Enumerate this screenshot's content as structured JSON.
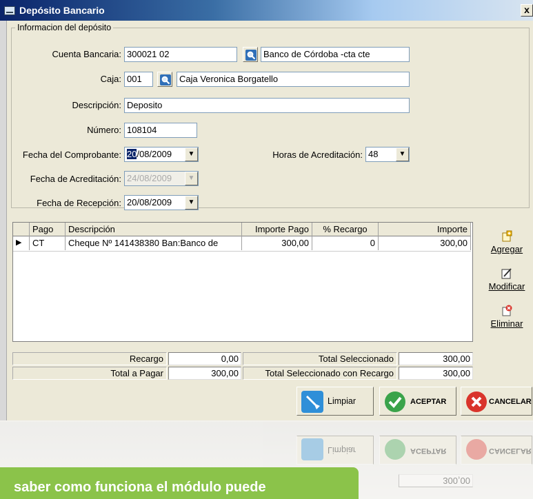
{
  "window": {
    "title": "Depósito Bancario",
    "close": "x"
  },
  "group": {
    "legend": "Informacion del depósito"
  },
  "form": {
    "cuenta_label": "Cuenta Bancaria:",
    "cuenta_value": "300021 02",
    "cuenta_name": "Banco de Córdoba -cta cte",
    "caja_label": "Caja:",
    "caja_value": "001",
    "caja_name": "Caja Veronica Borgatello",
    "descripcion_label": "Descripción:",
    "descripcion_value": "Deposito",
    "numero_label": "Número:",
    "numero_value": "108104",
    "fecha_comp_label": "Fecha del Comprobante:",
    "fecha_comp_sel": "20",
    "fecha_comp_rest": "/08/2009",
    "horas_label": "Horas de Acreditación:",
    "horas_value": "48",
    "fecha_acred_label": "Fecha de Acreditación:",
    "fecha_acred_value": "24/08/2009",
    "fecha_recep_label": "Fecha de Recepción:",
    "fecha_recep_value": "20/08/2009"
  },
  "grid": {
    "columns": [
      "Pago",
      "Descripción",
      "Importe Pago",
      "% Recargo",
      "Importe"
    ],
    "rows": [
      {
        "pago": "CT",
        "descripcion": "Cheque Nº 141438380 Ban:Banco de",
        "importe_pago": "300,00",
        "recargo": "0",
        "importe": "300,00"
      }
    ]
  },
  "side": {
    "agregar": "Agregar",
    "modificar": "Modificar",
    "eliminar": "Eliminar"
  },
  "totals": {
    "recargo_label": "Recargo",
    "recargo_value": "0,00",
    "total_sel_label": "Total Seleccionado",
    "total_sel_value": "300,00",
    "total_pagar_label": "Total a Pagar",
    "total_pagar_value": "300,00",
    "total_sel_rec_label": "Total Seleccionado con Recargo",
    "total_sel_rec_value": "300,00"
  },
  "actions": {
    "limpiar": "Limpiar",
    "aceptar": "ACEPTAR",
    "cancelar": "CANCELAR"
  },
  "banner": {
    "text": "saber como funciona el módulo puede"
  },
  "colors": {
    "accent": "#0a246a",
    "green": "#8bc34a",
    "cancel": "#d9342b",
    "ok": "#3aa34a"
  }
}
